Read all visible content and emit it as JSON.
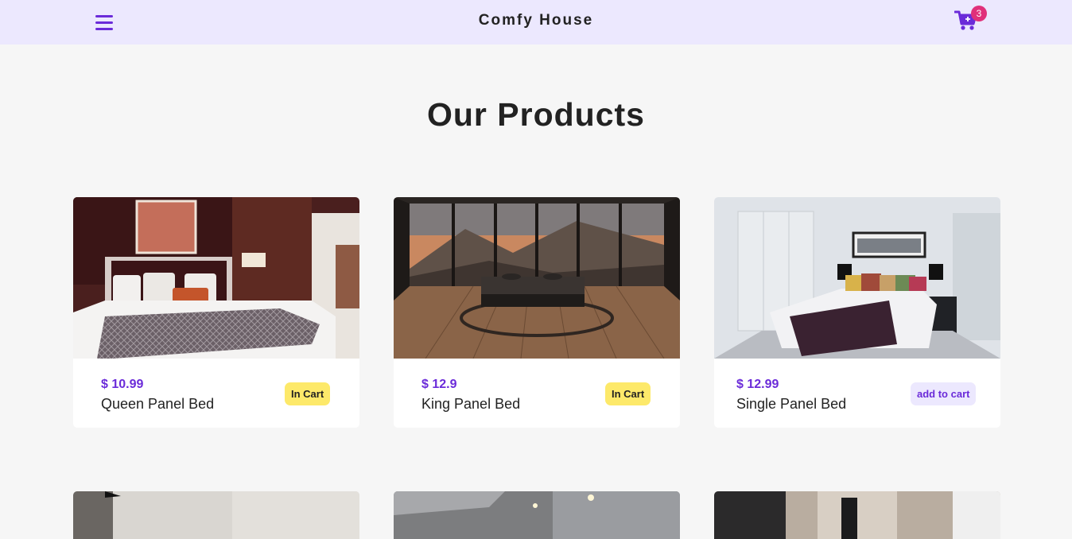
{
  "navbar": {
    "brand": "Comfy House",
    "menu_icon": "hamburger-menu-icon",
    "cart_icon": "cart-icon",
    "cart_count": "3",
    "accent_color": "#6b2bd9",
    "background_color": "#ece8fe"
  },
  "section": {
    "title": "Our Products"
  },
  "products": [
    {
      "price": "$ 10.99",
      "name": "Queen Panel Bed",
      "action": "In Cart"
    },
    {
      "price": "$ 12.9",
      "name": "King Panel Bed",
      "action": "In Cart"
    },
    {
      "price": "$ 12.99",
      "name": "Single Panel Bed",
      "action": "add to cart"
    }
  ]
}
